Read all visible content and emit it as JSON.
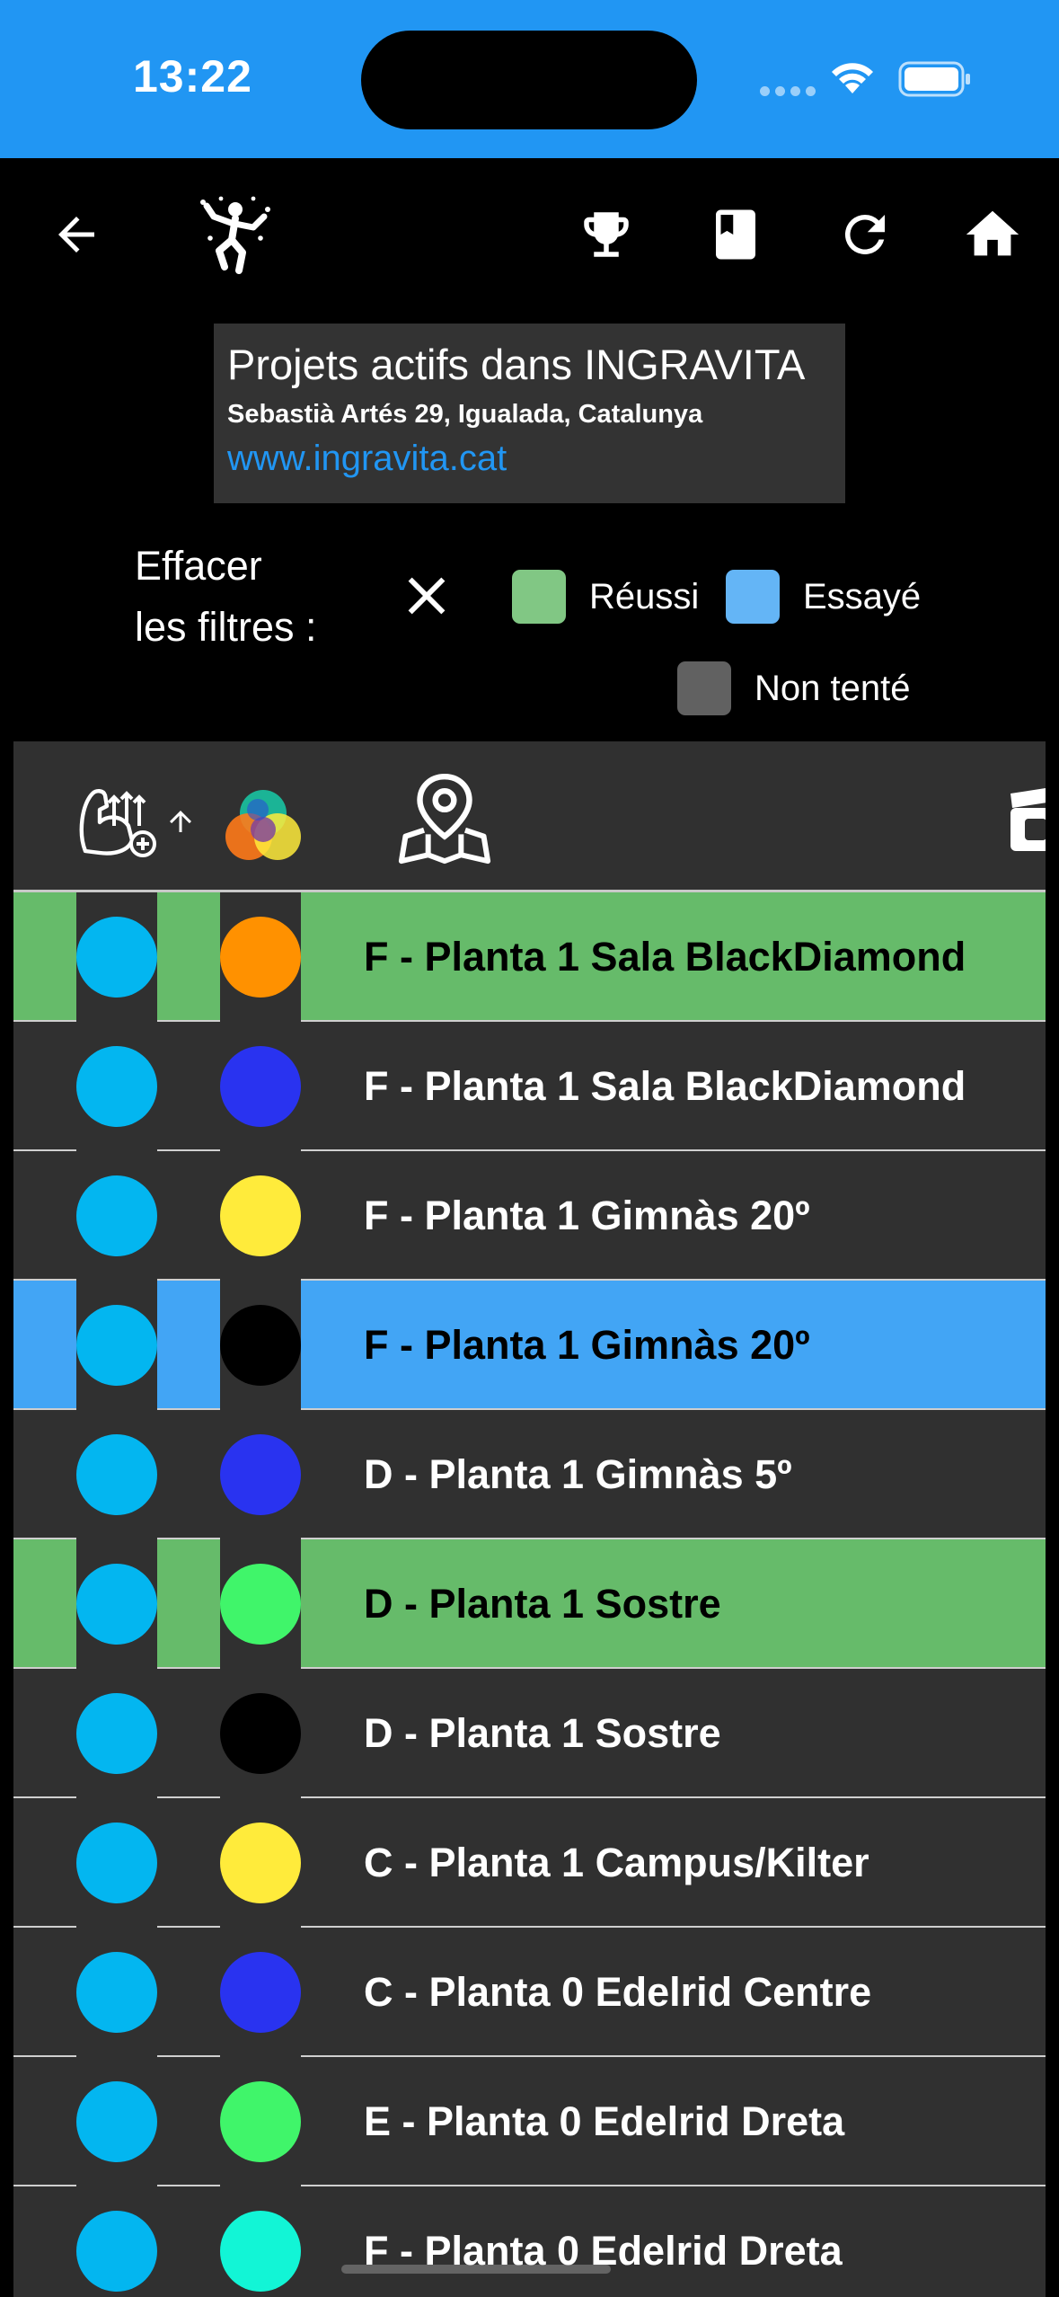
{
  "status_bar": {
    "time": "13:22",
    "background": "#2196f3"
  },
  "app_bar": {
    "icons": [
      "back-arrow-icon",
      "climber-logo-icon",
      "trophy-icon",
      "book-icon",
      "refresh-icon",
      "home-icon"
    ]
  },
  "gym": {
    "title": "Projets actifs dans INGRAVITA",
    "address": "Sebastià Artés 29, Igualada, Catalunya",
    "website": "www.ingravita.cat"
  },
  "filters": {
    "clear_label_line1": "Effacer",
    "clear_label_line2": "les filtres :",
    "legend": [
      {
        "label": "Réussi",
        "color": "#81c784"
      },
      {
        "label": "Essayé",
        "color": "#64b5f6"
      },
      {
        "label": "Non tenté",
        "color": "#616161"
      }
    ]
  },
  "table": {
    "header_icons": [
      "strength-sort-icon",
      "sort-ascending-icon",
      "color-venn-icon",
      "map-pin-icon",
      "video-clapper-icon"
    ],
    "rows": [
      {
        "name": "F - Planta 1 Sala BlackDiamond",
        "status": "Réussi",
        "row_color": "#66bb6a",
        "difficulty_color": "#03b6f0",
        "hold_color": "#ff9100",
        "text_color": "#000000"
      },
      {
        "name": "F - Planta 1 Sala BlackDiamond",
        "status": "Non tenté",
        "row_color": "#303030",
        "difficulty_color": "#03b6f0",
        "hold_color": "#2933f0",
        "text_color": "#ffffff"
      },
      {
        "name": "F - Planta 1 Gimnàs 20º",
        "status": "Non tenté",
        "row_color": "#303030",
        "difficulty_color": "#03b6f0",
        "hold_color": "#ffeb3b",
        "text_color": "#ffffff"
      },
      {
        "name": "F - Planta 1 Gimnàs 20º",
        "status": "Essayé",
        "row_color": "#42a5f5",
        "difficulty_color": "#03b6f0",
        "hold_color": "#000000",
        "text_color": "#000000"
      },
      {
        "name": "D - Planta 1 Gimnàs 5º",
        "status": "Non tenté",
        "row_color": "#303030",
        "difficulty_color": "#03b6f0",
        "hold_color": "#2933f0",
        "text_color": "#ffffff"
      },
      {
        "name": "D - Planta 1  Sostre",
        "status": "Réussi",
        "row_color": "#66bb6a",
        "difficulty_color": "#03b6f0",
        "hold_color": "#40f56a",
        "text_color": "#000000"
      },
      {
        "name": "D - Planta 1  Sostre",
        "status": "Non tenté",
        "row_color": "#303030",
        "difficulty_color": "#03b6f0",
        "hold_color": "#000000",
        "text_color": "#ffffff"
      },
      {
        "name": "C - Planta 1 Campus/Kilter",
        "status": "Non tenté",
        "row_color": "#303030",
        "difficulty_color": "#03b6f0",
        "hold_color": "#ffeb3b",
        "text_color": "#ffffff"
      },
      {
        "name": "C - Planta 0 Edelrid Centre",
        "status": "Non tenté",
        "row_color": "#303030",
        "difficulty_color": "#03b6f0",
        "hold_color": "#2933f0",
        "text_color": "#ffffff"
      },
      {
        "name": "E - Planta 0 Edelrid Dreta",
        "status": "Non tenté",
        "row_color": "#303030",
        "difficulty_color": "#03b6f0",
        "hold_color": "#40f56a",
        "text_color": "#ffffff"
      },
      {
        "name": "F - Planta 0 Edelrid Dreta",
        "status": "Non tenté",
        "row_color": "#303030",
        "difficulty_color": "#03b6f0",
        "hold_color": "#12f5d6",
        "text_color": "#ffffff"
      }
    ]
  }
}
